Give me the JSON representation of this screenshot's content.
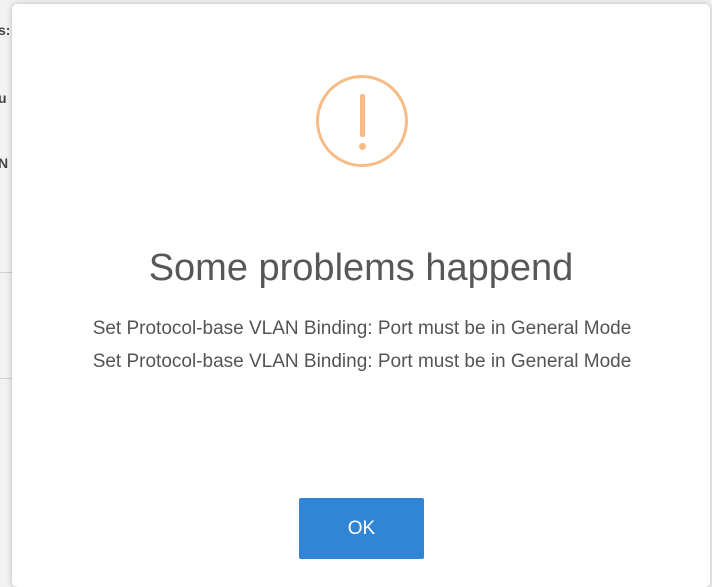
{
  "background": {
    "lines": [
      "s:",
      "u",
      "N"
    ]
  },
  "dialog": {
    "icon": "warning-exclamation-icon",
    "icon_color": "#f8bb86",
    "title": "Some problems happend",
    "messages": [
      "Set Protocol-base VLAN Binding: Port must be in General Mode",
      "Set Protocol-base VLAN Binding: Port must be in General Mode"
    ],
    "ok_label": "OK",
    "button_color": "#3085d6"
  }
}
